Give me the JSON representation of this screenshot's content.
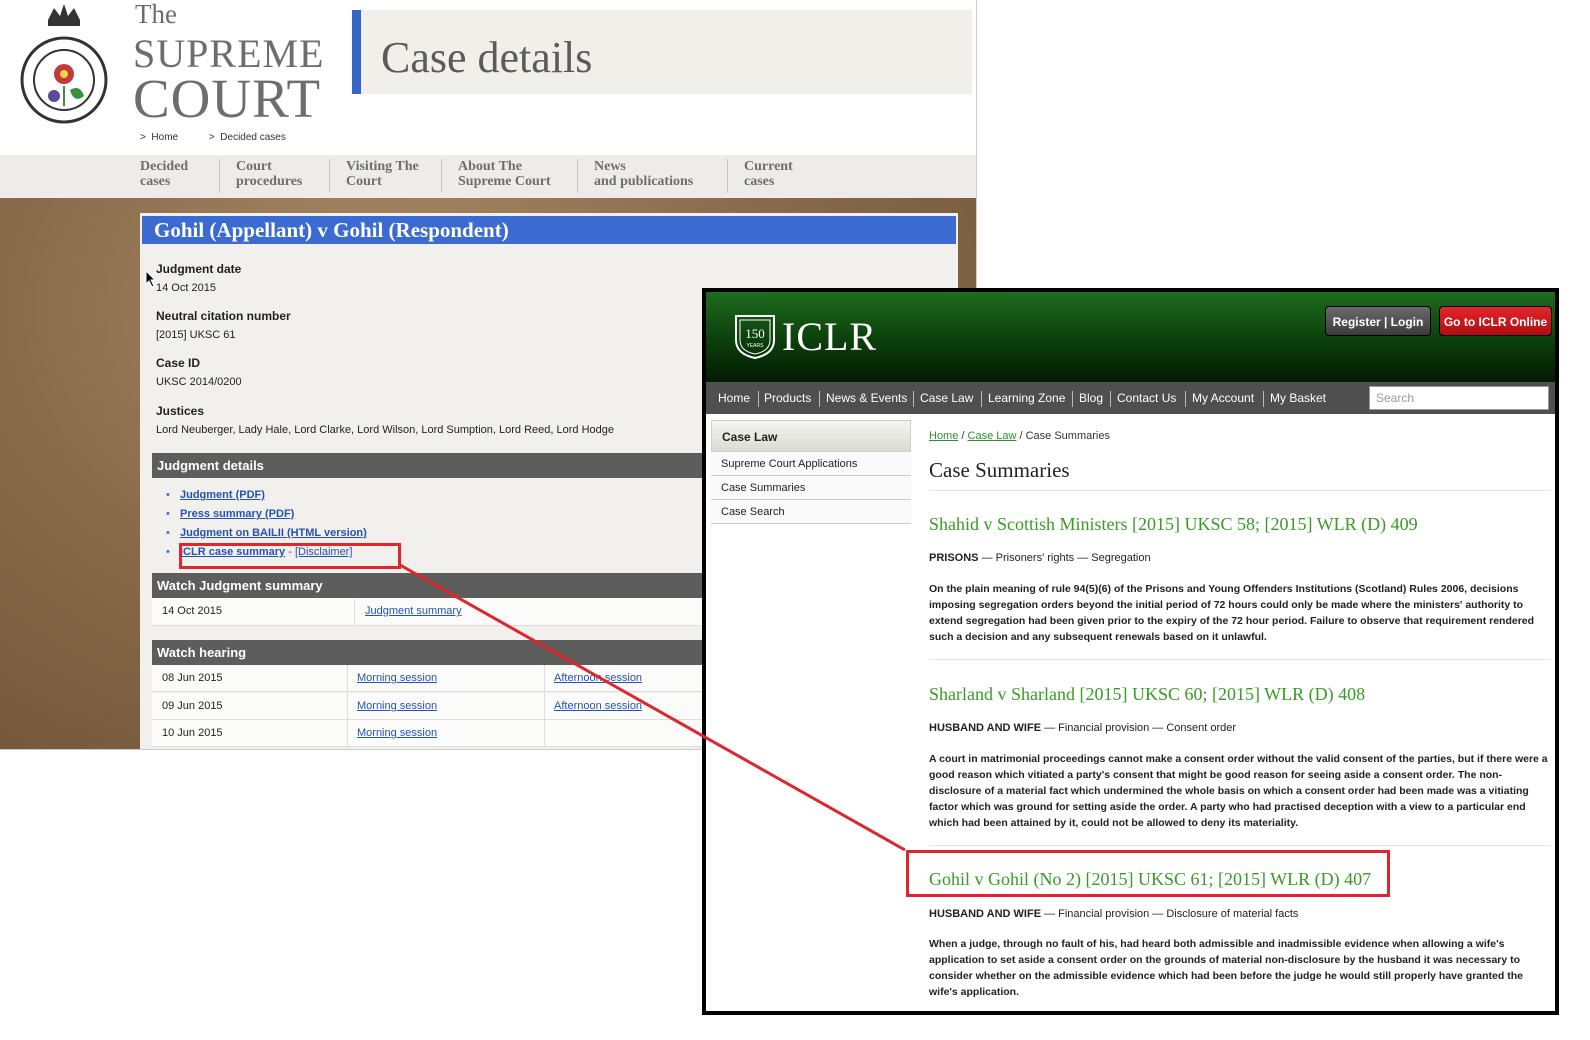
{
  "supreme_court": {
    "logo": {
      "the": "The",
      "line1": "SUPREME",
      "line2": "COURT"
    },
    "page_title": "Case details",
    "breadcrumb": {
      "home": "Home",
      "current": "Decided cases"
    },
    "nav": [
      {
        "line1": "Decided",
        "line2": "cases"
      },
      {
        "line1": "Court",
        "line2": "procedures"
      },
      {
        "line1": "Visiting The",
        "line2": "Court"
      },
      {
        "line1": "About The",
        "line2": "Supreme Court"
      },
      {
        "line1": "News",
        "line2": "and publications"
      },
      {
        "line1": "Current",
        "line2": "cases"
      }
    ],
    "case_title": "Gohil (Appellant) v Gohil (Respondent)",
    "fields": {
      "judgment_date_label": "Judgment date",
      "judgment_date": "14 Oct 2015",
      "neutral_citation_label": "Neutral citation number",
      "neutral_citation": "[2015] UKSC 61",
      "case_id_label": "Case ID",
      "case_id": "UKSC 2014/0200",
      "justices_label": "Justices",
      "justices": "Lord Neuberger, Lady Hale, Lord Clarke, Lord Wilson, Lord Sumption, Lord Reed, Lord Hodge"
    },
    "judgment_details": {
      "heading": "Judgment details",
      "links": {
        "judgment_pdf": "Judgment (PDF)",
        "press_summary": "Press summary (PDF)",
        "bailii": "Judgment on BAILII (HTML version)",
        "iclr": "ICLR case summary",
        "iclr_sep": " - ",
        "disclaimer": "[Disclaimer]"
      }
    },
    "watch_summary": {
      "heading": "Watch Judgment summary",
      "date": "14 Oct 2015",
      "link": "Judgment summary"
    },
    "watch_hearing": {
      "heading": "Watch hearing",
      "rows": [
        {
          "date": "08 Jun 2015",
          "morning": "Morning session",
          "afternoon": "Afternoon session"
        },
        {
          "date": "09 Jun 2015",
          "morning": "Morning session",
          "afternoon": "Afternoon session"
        },
        {
          "date": "10 Jun 2015",
          "morning": "Morning session",
          "afternoon": ""
        }
      ]
    }
  },
  "iclr": {
    "logo": {
      "years_num": "150",
      "years": "YEARS",
      "name": "ICLR"
    },
    "buttons": {
      "login": "Register | Login",
      "goto": "Go to ICLR Online"
    },
    "nav": [
      "Home",
      "Products",
      "News & Events",
      "Case Law",
      "Learning Zone",
      "Blog",
      "Contact Us",
      "My Account",
      "My Basket"
    ],
    "search_placeholder": "Search",
    "sidebar": {
      "heading": "Case Law",
      "items": [
        "Supreme Court Applications",
        "Case Summaries",
        "Case Search"
      ]
    },
    "breadcrumb": {
      "home": "Home",
      "sep": " / ",
      "case_law": "Case Law",
      "current": " / Case Summaries"
    },
    "heading": "Case Summaries",
    "cases": [
      {
        "title": "Shahid v Scottish Ministers [2015] UKSC 58; [2015] WLR (D) 409",
        "category": "PRISONS",
        "subject": " — Prisoners' rights — Segregation",
        "summary": "On the plain meaning of rule 94(5)(6) of the Prisons and Young Offenders Institutions (Scotland) Rules 2006, decisions imposing segregation orders beyond the initial period of 72 hours could only be made where the ministers' authority to extend segregation had been given prior to the expiry of the 72 hour period. Failure to observe that requirement rendered such a decision and any subsequent renewals based on it unlawful."
      },
      {
        "title": "Sharland v Sharland [2015] UKSC 60; [2015] WLR (D) 408",
        "category": "HUSBAND AND WIFE",
        "subject": " — Financial provision — Consent order",
        "summary": "A court in matrimonial proceedings cannot make a consent order without the valid consent of the parties, but if there were a good reason which vitiated a party's consent that might be good reason for seeing aside a consent order. The non-disclosure of a material fact which undermined the whole basis on which a consent order had been made was a vitiating factor which was ground for setting aside the order. A party who had practised deception with a view to a particular end which had been attained by it, could not be allowed to deny its materiality."
      },
      {
        "title": "Gohil v Gohil (No 2) [2015] UKSC 61; [2015] WLR (D) 407",
        "category": "HUSBAND AND WIFE",
        "subject": " — Financial provision — Disclosure of material facts",
        "summary": "When a judge, through no fault of his, had heard both admissible and inadmissible evidence when allowing a wife's application to set aside a consent order on the grounds of material non-disclosure by the husband it was necessary to consider whether on the admissible evidence which had been before the judge he would still properly have granted the wife's application."
      }
    ]
  },
  "colors": {
    "court_blue": "#3b6bd0",
    "iclr_green": "#389b24",
    "highlight_red": "#e0262c"
  }
}
